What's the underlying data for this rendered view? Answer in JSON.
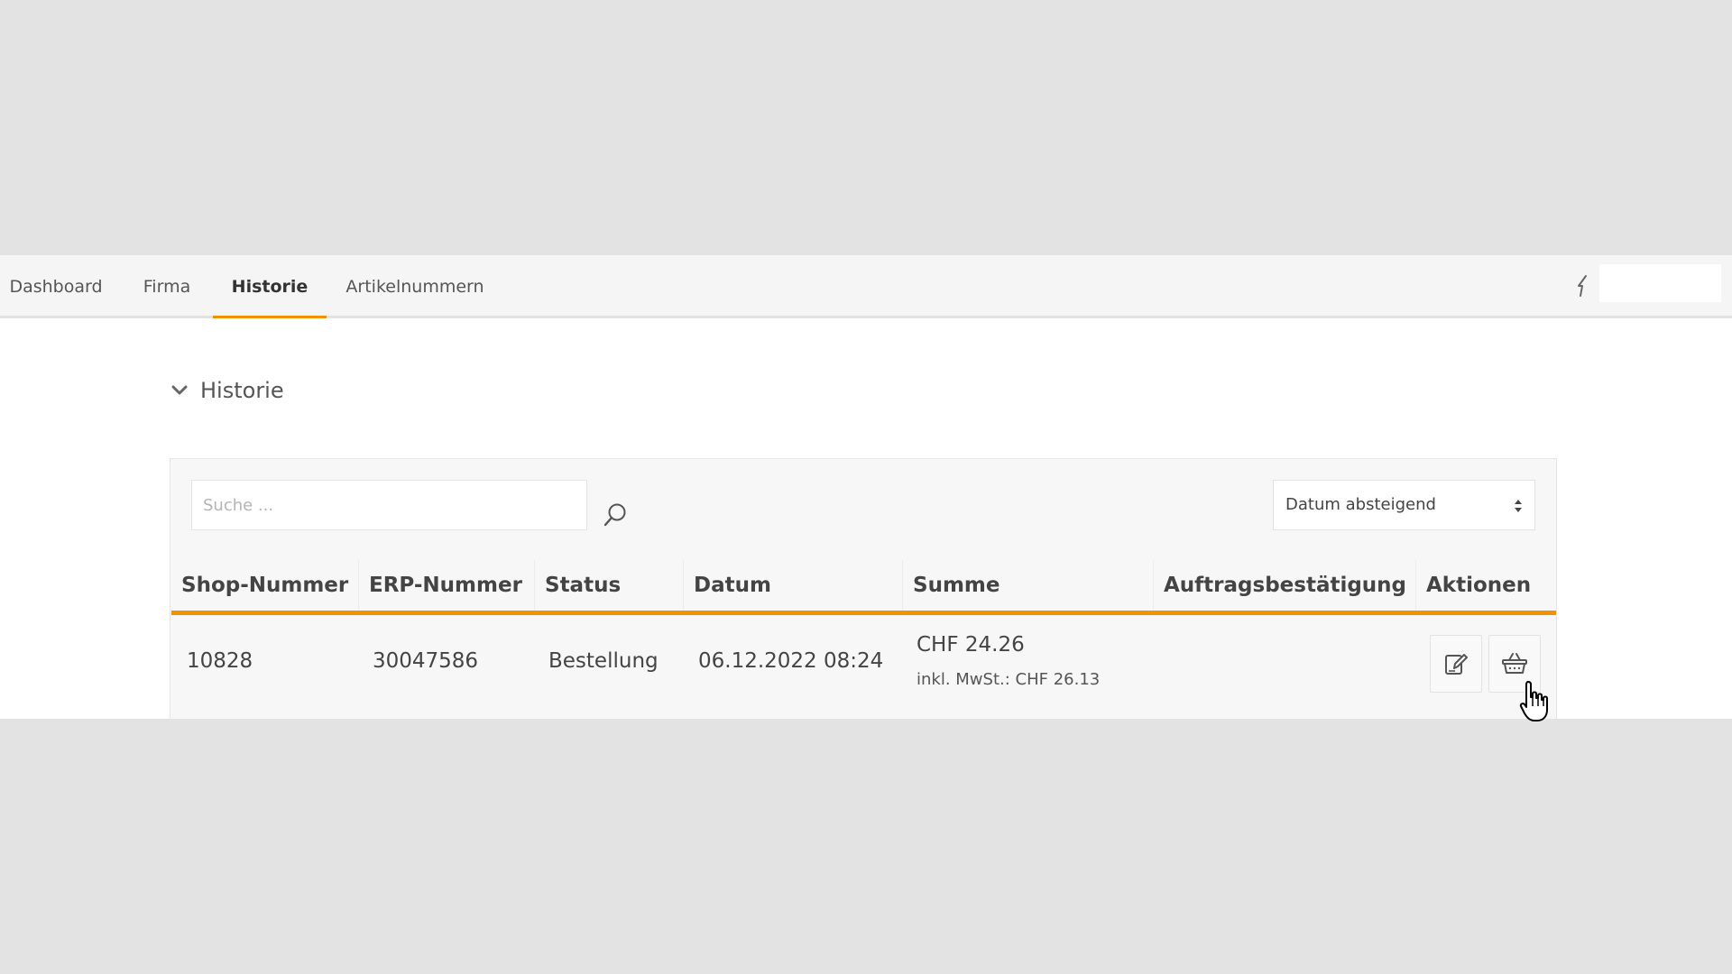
{
  "nav": {
    "tabs": [
      {
        "label": "Dashboard"
      },
      {
        "label": "Firma"
      },
      {
        "label": "Historie"
      },
      {
        "label": "Artikelnummern"
      }
    ],
    "active_tab": "Historie",
    "accent_color": "#f39200"
  },
  "section": {
    "title": "Historie"
  },
  "toolbar": {
    "search_placeholder": "Suche ...",
    "search_value": "",
    "sort_selected": "Datum absteigend"
  },
  "table": {
    "columns": [
      "Shop-Nummer",
      "ERP-Nummer",
      "Status",
      "Datum",
      "Summe",
      "Auftragsbestätigung",
      "Aktionen"
    ],
    "rows": [
      {
        "shop_nummer": "10828",
        "erp_nummer": "30047586",
        "status": "Bestellung",
        "datum": "06.12.2022 08:24",
        "summe": "CHF 24.26",
        "summe_inkl": "inkl. MwSt.: CHF 26.13",
        "auftragsbestaetigung": "",
        "actions": [
          "edit-icon",
          "basket-icon"
        ]
      }
    ]
  }
}
